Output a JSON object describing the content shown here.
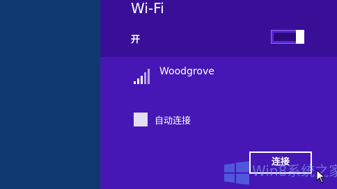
{
  "panel": {
    "title": "Wi-Fi",
    "toggle": {
      "label": "开",
      "state": "on"
    },
    "network": {
      "name": "Woodgrove",
      "icon": "wifi-signal-icon"
    },
    "auto_connect": {
      "label": "自动连接",
      "checked": false
    },
    "connect_button": {
      "label": "连接"
    }
  },
  "watermark": {
    "text": "Win8系统之家"
  },
  "colors": {
    "desktop": "#0e3a70",
    "panel": "#4617b4",
    "panel_header": "#3a0f98",
    "text": "#ffffff"
  }
}
